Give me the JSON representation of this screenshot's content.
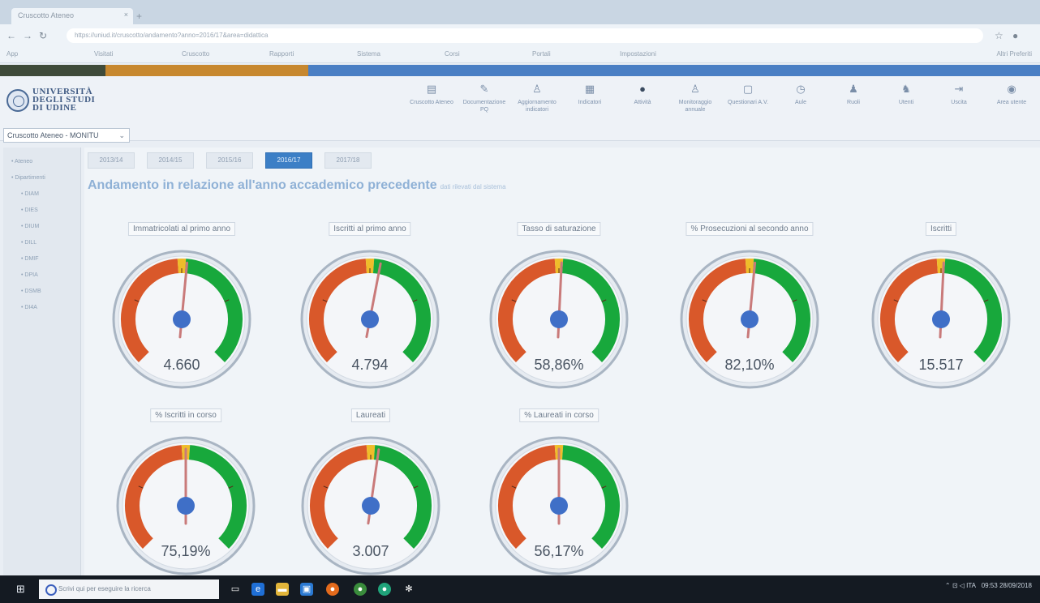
{
  "browser": {
    "tab_title": "Cruscotto Ateneo",
    "url": "https://uniud.it/cruscotto/andamento?anno=2016/17&area=didattica",
    "bookmarks": [
      "App",
      "Visitati",
      "Cruscotto",
      "Rapporti",
      "Sistema",
      "Corsi",
      "Portali",
      "Impostazioni",
      "Altri Preferiti"
    ]
  },
  "brand": {
    "colors": {
      "dark_strip": "#3f4b3a",
      "orange_strip": "#c7882f",
      "blue_strip": "#4a7fc4",
      "gauge_red": "#d9582a",
      "gauge_yellow": "#efbd2a",
      "gauge_green": "#18a83c",
      "needle": "#c97a7a",
      "hub": "#3f6fc7"
    },
    "logo": {
      "line1": "UNIVERSITÀ",
      "line2": "DEGLI STUDI",
      "line3": "DI UDINE"
    }
  },
  "menu": [
    {
      "label": "Cruscotto Ateneo",
      "icon": "chart-icon"
    },
    {
      "label": "Documentazione PQ",
      "icon": "doc-icon"
    },
    {
      "label": "Aggiornamento indicatori",
      "icon": "user-edit-icon"
    },
    {
      "label": "Indicatori",
      "icon": "table-icon"
    },
    {
      "label": "Attività",
      "icon": "person-icon"
    },
    {
      "label": "Monitoraggio annuale",
      "icon": "user-edit-icon"
    },
    {
      "label": "Questionari A.V.",
      "icon": "form-icon"
    },
    {
      "label": "Aule",
      "icon": "clock-icon"
    },
    {
      "label": "Ruoli",
      "icon": "people-icon"
    },
    {
      "label": "Utenti",
      "icon": "user-icon"
    },
    {
      "label": "Uscita",
      "icon": "logout-icon"
    },
    {
      "label": "Area utente",
      "icon": "avatar-icon"
    }
  ],
  "selector": {
    "value": "Cruscotto Ateneo - MONITU"
  },
  "sidebar": {
    "items": [
      "Ateneo",
      "Dipartimenti",
      "DIAM",
      "DIES",
      "DIUM",
      "DILL",
      "DMIF",
      "DPIA",
      "DSMB",
      "DI4A"
    ]
  },
  "years": [
    "2013/14",
    "2014/15",
    "2015/16",
    "2016/17",
    "2017/18"
  ],
  "active_year": "2016/17",
  "heading": "Andamento in relazione all'anno accademico precedente",
  "heading_note": "dati rilevati dal sistema",
  "gauges": [
    {
      "label": "Immatricolati al primo anno",
      "value": "4.660",
      "level": 0.52
    },
    {
      "label": "Iscritti al primo anno",
      "value": "4.794",
      "level": 0.54
    },
    {
      "label": "Tasso di saturazione",
      "value": "58,86%",
      "level": 0.51
    },
    {
      "label": "% Prosecuzioni al secondo anno",
      "value": "82,10%",
      "level": 0.52
    },
    {
      "label": "Iscritti",
      "value": "15.517",
      "level": 0.51
    },
    {
      "label": "% Iscritti in corso",
      "value": "75,19%",
      "level": 0.5
    },
    {
      "label": "Laureati",
      "value": "3.007",
      "level": 0.53
    },
    {
      "label": "% Laureati in corso",
      "value": "56,17%",
      "level": 0.5
    }
  ],
  "taskbar": {
    "search_placeholder": "Scrivi qui per eseguire la ricerca",
    "time": "09:53",
    "date": "28/09/2018"
  }
}
